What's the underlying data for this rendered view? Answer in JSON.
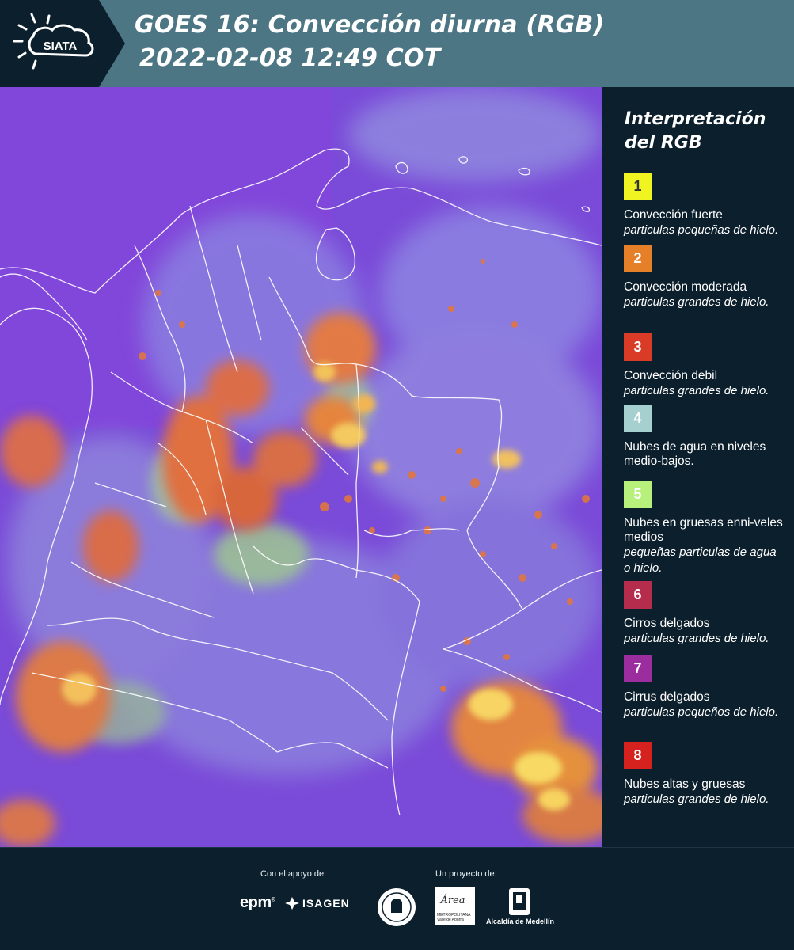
{
  "header": {
    "logo_text": "SIATA",
    "title_line1": "GOES 16: Convección diurna (RGB)",
    "title_line2": "2022-02-08 12:49 COT",
    "background_color": "#4d7684"
  },
  "map": {
    "description_icon": "satellite-rgb-convection-map",
    "base_color": "#7a4ad8"
  },
  "legend": {
    "title_line1": "Interpretación",
    "title_line2": "del RGB",
    "items": [
      {
        "number": "1",
        "color": "#f0f522",
        "text_color": "#333333",
        "name": "Convección fuerte",
        "sub": "particulas pequeñas de hielo."
      },
      {
        "number": "2",
        "color": "#e58029",
        "text_color": "#ffffff",
        "name": "Convección moderada",
        "sub": "particulas grandes de hielo."
      },
      {
        "number": "3",
        "color": "#d93b26",
        "text_color": "#ffffff",
        "name": "Convección debil",
        "sub": "particulas grandes de hielo."
      },
      {
        "number": "4",
        "color": "#a6cfcf",
        "text_color": "#ffffff",
        "name": "Nubes de agua en niveles medio-bajos.",
        "sub": ""
      },
      {
        "number": "5",
        "color": "#b8f07c",
        "text_color": "#ffffff",
        "name": "Nubes en gruesas enni-veles medios",
        "sub": "pequeñas particulas de agua o hielo."
      },
      {
        "number": "6",
        "color": "#b62c4d",
        "text_color": "#ffffff",
        "name": "Cirros delgados",
        "sub": "particulas grandes de hielo."
      },
      {
        "number": "7",
        "color": "#9b2d9e",
        "text_color": "#ffffff",
        "name": "Cirrus delgados",
        "sub": "particulas pequeños de hielo."
      },
      {
        "number": "8",
        "color": "#d6221f",
        "text_color": "#ffffff",
        "name": "Nubes altas y gruesas",
        "sub": "particulas grandes de hielo."
      }
    ]
  },
  "footer": {
    "support_label": "Con el apoyo de:",
    "project_label": "Un proyecto de:",
    "epm": "epm",
    "isagen": "ISAGEN",
    "area_title": "Área",
    "area_sub1": "METROPOLITANA",
    "area_sub2": "Valle de Aburrá",
    "alcaldia": "Alcaldía de Medellín"
  }
}
